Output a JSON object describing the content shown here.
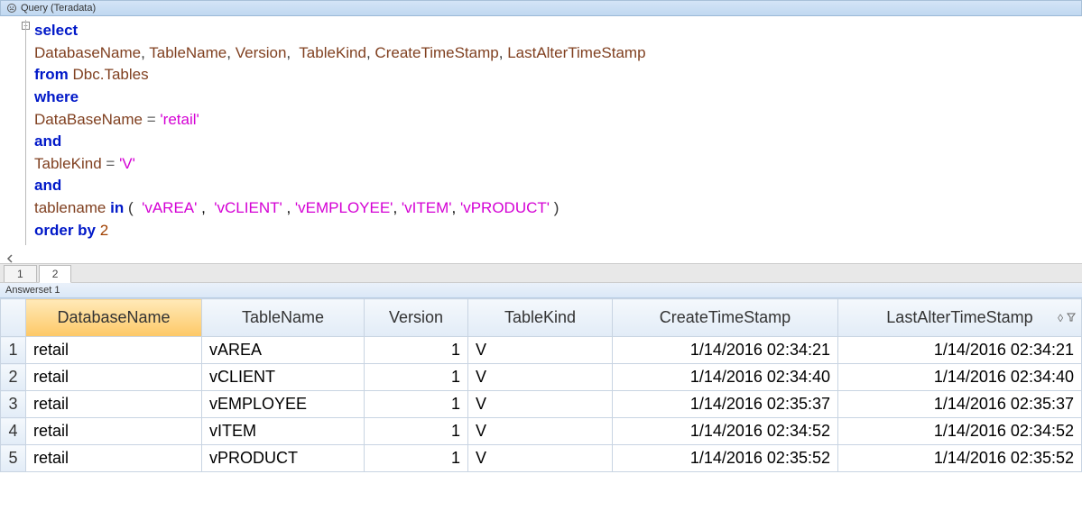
{
  "queryPanel": {
    "title": "Query (Teradata)"
  },
  "sql": {
    "tokens": [
      [
        {
          "t": "kw",
          "v": "select"
        }
      ],
      [
        {
          "t": "ident",
          "v": "DatabaseName"
        },
        {
          "t": "punc",
          "v": ", "
        },
        {
          "t": "ident",
          "v": "TableName"
        },
        {
          "t": "punc",
          "v": ", "
        },
        {
          "t": "ident",
          "v": "Version"
        },
        {
          "t": "punc",
          "v": ",  "
        },
        {
          "t": "ident",
          "v": "TableKind"
        },
        {
          "t": "punc",
          "v": ", "
        },
        {
          "t": "ident",
          "v": "CreateTimeStamp"
        },
        {
          "t": "punc",
          "v": ", "
        },
        {
          "t": "ident",
          "v": "LastAlterTimeStamp"
        }
      ],
      [
        {
          "t": "kw",
          "v": "from"
        },
        {
          "t": "blk",
          "v": " "
        },
        {
          "t": "ident",
          "v": "Dbc.Tables"
        }
      ],
      [
        {
          "t": "kw",
          "v": "where"
        }
      ],
      [
        {
          "t": "ident",
          "v": "DataBaseName "
        },
        {
          "t": "op",
          "v": "="
        },
        {
          "t": "blk",
          "v": " "
        },
        {
          "t": "str",
          "v": "'retail'"
        }
      ],
      [
        {
          "t": "kw",
          "v": "and"
        }
      ],
      [
        {
          "t": "ident",
          "v": "TableKind "
        },
        {
          "t": "op",
          "v": "="
        },
        {
          "t": "blk",
          "v": " "
        },
        {
          "t": "str",
          "v": "'V'"
        }
      ],
      [
        {
          "t": "kw",
          "v": "and"
        }
      ],
      [
        {
          "t": "ident",
          "v": "tablename "
        },
        {
          "t": "kw",
          "v": "in"
        },
        {
          "t": "blk",
          "v": " "
        },
        {
          "t": "punc",
          "v": "(  "
        },
        {
          "t": "str",
          "v": "'vAREA'"
        },
        {
          "t": "blk",
          "v": " ,  "
        },
        {
          "t": "str",
          "v": "'vCLIENT'"
        },
        {
          "t": "blk",
          "v": " , "
        },
        {
          "t": "str",
          "v": "'vEMPLOYEE'"
        },
        {
          "t": "blk",
          "v": ", "
        },
        {
          "t": "str",
          "v": "'vITEM'"
        },
        {
          "t": "blk",
          "v": ", "
        },
        {
          "t": "str",
          "v": "'vPRODUCT'"
        },
        {
          "t": "blk",
          "v": " "
        },
        {
          "t": "punc",
          "v": ")"
        }
      ],
      [
        {
          "t": "kw",
          "v": "order by"
        },
        {
          "t": "blk",
          "v": " "
        },
        {
          "t": "num",
          "v": "2"
        }
      ]
    ]
  },
  "tabs": {
    "items": [
      {
        "label": "1",
        "active": false
      },
      {
        "label": "2",
        "active": true
      }
    ]
  },
  "answerset": {
    "title": "Answerset 1"
  },
  "grid": {
    "columns": [
      {
        "label": "DatabaseName",
        "sel": true,
        "cls": "col-db",
        "align": "l"
      },
      {
        "label": "TableName",
        "sel": false,
        "cls": "col-tn",
        "align": "l"
      },
      {
        "label": "Version",
        "sel": false,
        "cls": "col-ver",
        "align": "r"
      },
      {
        "label": "TableKind",
        "sel": false,
        "cls": "col-tk",
        "align": "l"
      },
      {
        "label": "CreateTimeStamp",
        "sel": false,
        "cls": "col-cts",
        "align": "r"
      },
      {
        "label": "LastAlterTimeStamp",
        "sel": false,
        "cls": "col-lats",
        "align": "r"
      }
    ],
    "rows": [
      {
        "n": "1",
        "cells": [
          "retail",
          "vAREA",
          "1",
          "V",
          "1/14/2016 02:34:21",
          "1/14/2016 02:34:21"
        ]
      },
      {
        "n": "2",
        "cells": [
          "retail",
          "vCLIENT",
          "1",
          "V",
          "1/14/2016 02:34:40",
          "1/14/2016 02:34:40"
        ]
      },
      {
        "n": "3",
        "cells": [
          "retail",
          "vEMPLOYEE",
          "1",
          "V",
          "1/14/2016 02:35:37",
          "1/14/2016 02:35:37"
        ]
      },
      {
        "n": "4",
        "cells": [
          "retail",
          "vITEM",
          "1",
          "V",
          "1/14/2016 02:34:52",
          "1/14/2016 02:34:52"
        ]
      },
      {
        "n": "5",
        "cells": [
          "retail",
          "vPRODUCT",
          "1",
          "V",
          "1/14/2016 02:35:52",
          "1/14/2016 02:35:52"
        ]
      }
    ]
  }
}
